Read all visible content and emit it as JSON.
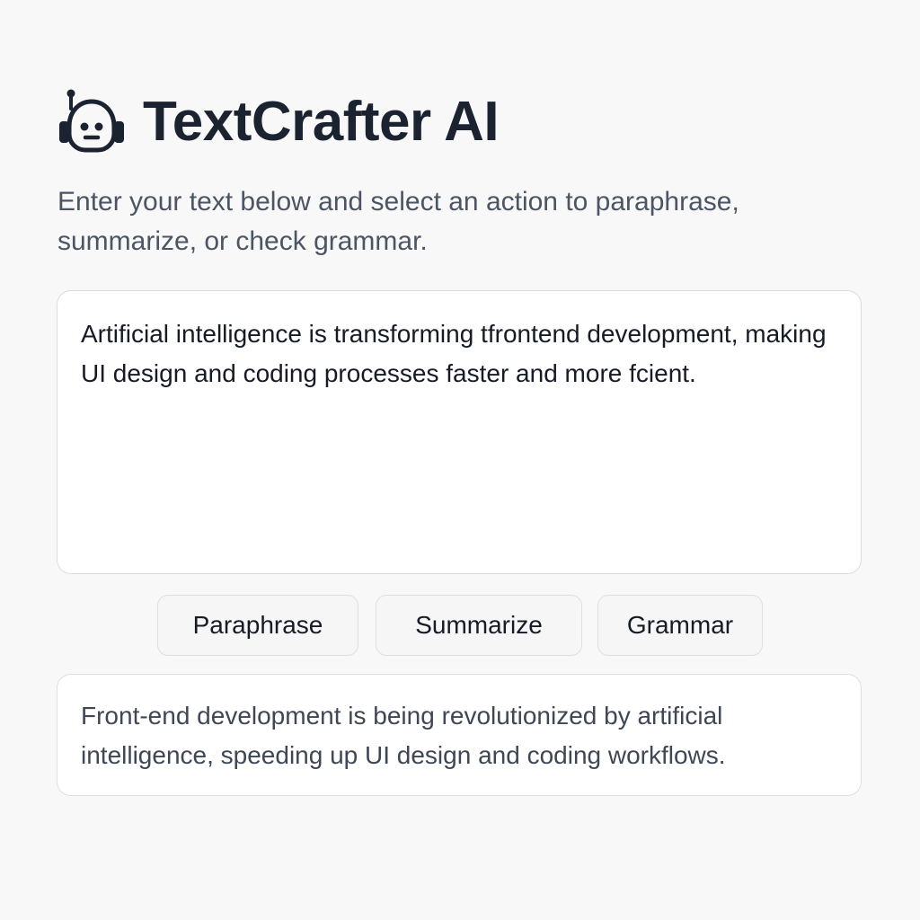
{
  "app": {
    "title": "TextCrafter AI",
    "logo_icon": "robot-headset-icon",
    "subtitle": "Enter your text below and select an action to paraphrase, summarize, or check grammar."
  },
  "input": {
    "value": "Artificial intelligence is transforming tfrontend development, making UI design and coding processes faster and more fcient."
  },
  "actions": {
    "paraphrase_label": "Paraphrase",
    "summarize_label": "Summarize",
    "grammar_label": "Grammar"
  },
  "output": {
    "text": "Front-end development is being revolutionized by artificial intelligence, speeding up UI design and coding workflows."
  },
  "colors": {
    "background": "#f8f8f8",
    "title": "#1b2230",
    "subtitle": "#4b5563",
    "border": "#dcdfe4"
  }
}
